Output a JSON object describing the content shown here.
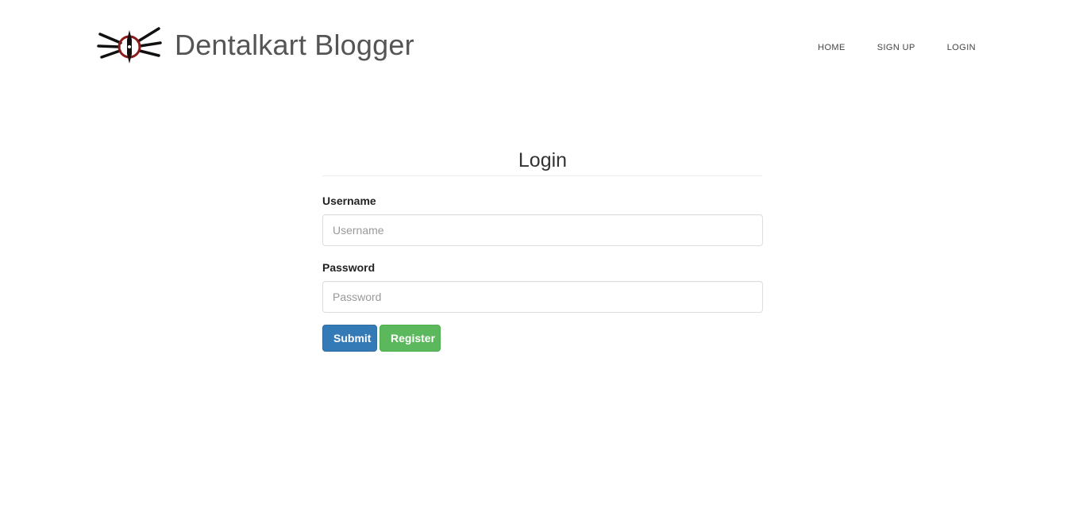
{
  "brand": {
    "name": "Dentalkart Blogger",
    "logo_icon": "dentalkart-logo-icon",
    "logo_colors": {
      "lines": "#111111",
      "ring": "#8b1a1a",
      "core": "#111111"
    }
  },
  "nav": {
    "items": [
      {
        "label": "HOME"
      },
      {
        "label": "SIGN UP"
      },
      {
        "label": "LOGIN"
      }
    ]
  },
  "login": {
    "title": "Login",
    "username": {
      "label": "Username",
      "placeholder": "Username",
      "value": ""
    },
    "password": {
      "label": "Password",
      "placeholder": "Password",
      "value": ""
    },
    "submit_label": "Submit",
    "register_label": "Register"
  },
  "colors": {
    "primary": "#337ab7",
    "success": "#5cb85c",
    "text": "#333333"
  }
}
